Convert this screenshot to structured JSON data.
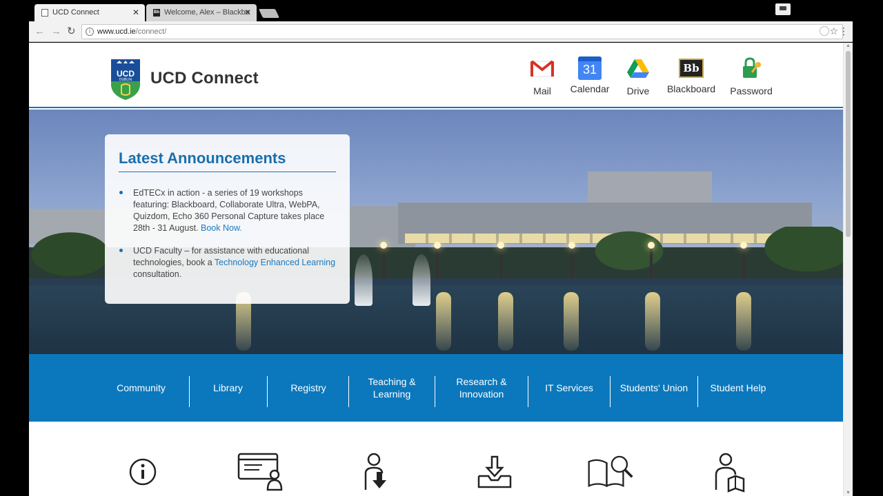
{
  "browser": {
    "tabs": [
      {
        "title": "UCD Connect",
        "active": true
      },
      {
        "title": "Welcome, Alex – Blackbo",
        "active": false
      }
    ],
    "url_host": "www.ucd.ie",
    "url_path": "/connect/"
  },
  "header": {
    "crest_text": "UCD",
    "crest_subtext": "DUBLIN",
    "title": "UCD Connect",
    "quick_links": [
      {
        "label": "Mail",
        "icon": "gmail-icon"
      },
      {
        "label": "Calendar",
        "icon": "calendar-icon",
        "day": "31"
      },
      {
        "label": "Drive",
        "icon": "drive-icon"
      },
      {
        "label": "Blackboard",
        "icon": "blackboard-icon",
        "text": "Bb"
      },
      {
        "label": "Password",
        "icon": "password-lock-icon"
      }
    ]
  },
  "announcements": {
    "heading": "Latest Announcements",
    "items": [
      {
        "text": "EdTECx in action - a series of 19 workshops featuring: Blackboard, Collaborate Ultra, WebPA, Quizdom, Echo 360 Personal Capture takes place 28th - 31 August.",
        "link": "Book Now."
      },
      {
        "text": "UCD Faculty – for assistance with educational technologies, book a",
        "link": "Technology Enhanced Learning",
        "after": "consultation."
      }
    ]
  },
  "nav": {
    "items": [
      "Community",
      "Library",
      "Registry",
      "Teaching &\nLearning",
      "Research &\nInnovation",
      "IT Services",
      "Students' Union",
      "Student Help"
    ]
  },
  "services": {
    "icons": [
      "info-icon",
      "web-profile-icon",
      "person-download-icon",
      "download-tray-icon",
      "search-book-icon",
      "person-reading-icon"
    ]
  },
  "colors": {
    "brand_blue": "#0b78bd",
    "heading_blue": "#1a6fad"
  }
}
